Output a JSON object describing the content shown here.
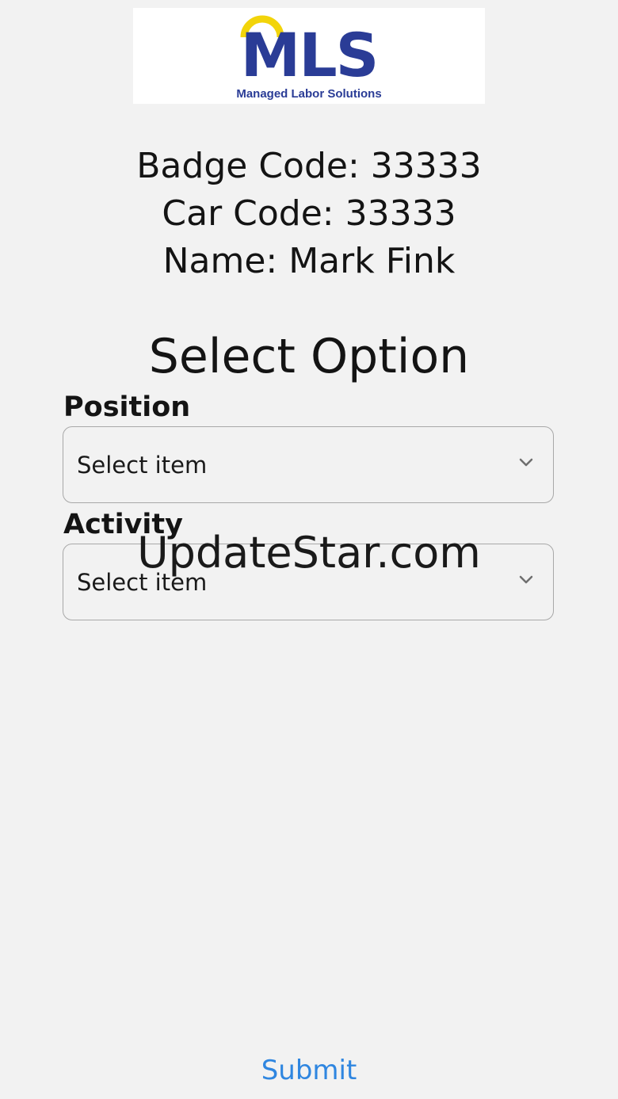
{
  "logo": {
    "mark": "MLS",
    "tagline": "Managed Labor Solutions"
  },
  "info": {
    "badge": "Badge Code: 33333",
    "car": "Car Code: 33333",
    "name": "Name: Mark Fink"
  },
  "title": "Select Option",
  "fields": [
    {
      "label": "Position",
      "value": "Select item"
    },
    {
      "label": "Activity",
      "value": "Select item"
    }
  ],
  "watermark": "UpdateStar.com",
  "submit_label": "Submit",
  "colors": {
    "background": "#f2f2f2",
    "brand_blue": "#2a3c96",
    "brand_yellow": "#f2d40a",
    "link_blue": "#2f86e0"
  },
  "icons": {
    "dropdown": "chevron-down-icon"
  }
}
